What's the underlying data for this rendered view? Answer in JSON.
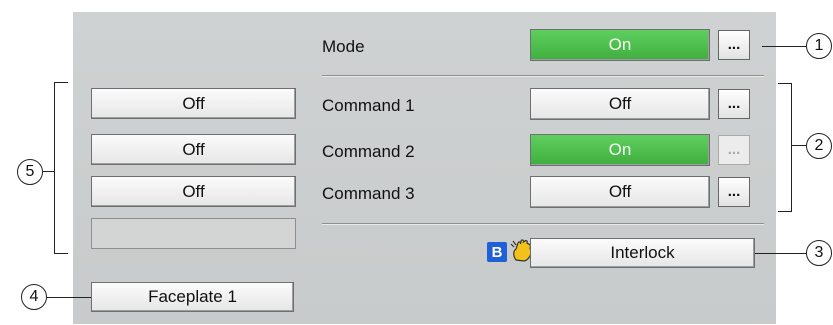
{
  "mode": {
    "label": "Mode",
    "value": "On"
  },
  "commands": [
    {
      "label": "Command 1",
      "value": "Off",
      "state": "off"
    },
    {
      "label": "Command 2",
      "value": "On",
      "state": "on"
    },
    {
      "label": "Command 3",
      "value": "Off",
      "state": "off"
    }
  ],
  "left_buttons": [
    "Off",
    "Off",
    "Off",
    ""
  ],
  "more_label": "...",
  "interlock": {
    "label": "Interlock"
  },
  "status_icons": {
    "b_label": "B",
    "icons": [
      "b-icon",
      "hand-icon",
      "lock-open-icon"
    ]
  },
  "faceplate": {
    "label": "Faceplate 1"
  },
  "callouts": [
    "1",
    "2",
    "3",
    "4",
    "5"
  ],
  "colors": {
    "panel": "#cbcece",
    "on_green": "#4cc14c",
    "b_blue": "#1f60d8"
  }
}
